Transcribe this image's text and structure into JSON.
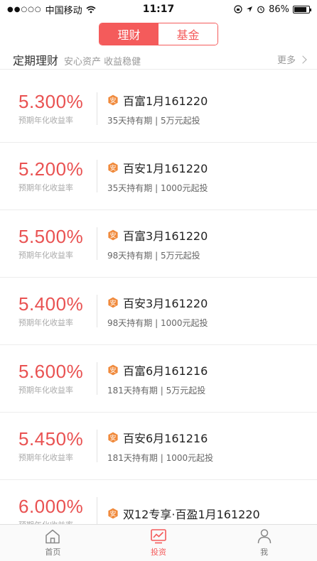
{
  "status_bar": {
    "carrier": "中国移动",
    "time": "11:17",
    "battery": "86%",
    "battery_level": 0.86
  },
  "segmented": {
    "tabs": [
      {
        "label": "理财",
        "active": true
      },
      {
        "label": "基金",
        "active": false
      }
    ]
  },
  "section": {
    "title": "定期理财",
    "subtitle": "安心资产 收益稳健",
    "more": "更多"
  },
  "products": [
    {
      "rate": "5.300%",
      "rate_label": "预期年化收益率",
      "name": "百富1月161220",
      "terms": "35天持有期 | 5万元起投"
    },
    {
      "rate": "5.200%",
      "rate_label": "预期年化收益率",
      "name": "百安1月161220",
      "terms": "35天持有期 | 1000元起投"
    },
    {
      "rate": "5.500%",
      "rate_label": "预期年化收益率",
      "name": "百富3月161220",
      "terms": "98天持有期 | 5万元起投"
    },
    {
      "rate": "5.400%",
      "rate_label": "预期年化收益率",
      "name": "百安3月161220",
      "terms": "98天持有期 | 1000元起投"
    },
    {
      "rate": "5.600%",
      "rate_label": "预期年化收益率",
      "name": "百富6月161216",
      "terms": "181天持有期 | 5万元起投"
    },
    {
      "rate": "5.450%",
      "rate_label": "预期年化收益率",
      "name": "百安6月161216",
      "terms": "181天持有期 | 1000元起投"
    },
    {
      "rate": "6.000%",
      "rate_label": "预期年化收益率",
      "name": "双12专享·百盈1月161220",
      "terms": ""
    }
  ],
  "badge_glyph": "安",
  "tab_bar": {
    "tabs": [
      {
        "label": "首页",
        "icon": "home-icon",
        "active": false
      },
      {
        "label": "投资",
        "icon": "chart-icon",
        "active": true
      },
      {
        "label": "我",
        "icon": "person-icon",
        "active": false
      }
    ]
  },
  "colors": {
    "accent": "#f45b5b",
    "rate": "#e95252",
    "badge": "#f08a3c"
  }
}
